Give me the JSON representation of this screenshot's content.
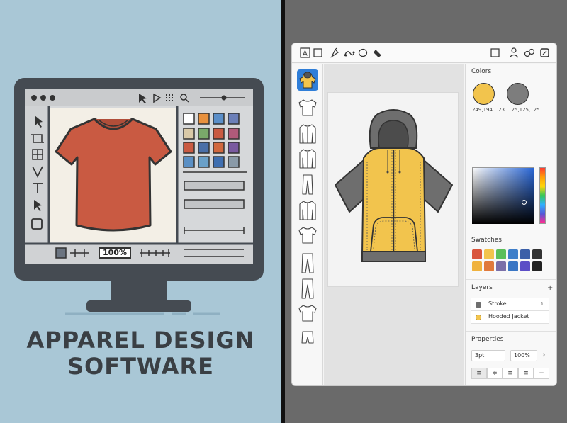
{
  "left": {
    "title_line1": "APPAREL DESIGN",
    "title_line2": "SOFTWARE",
    "zoom_label": "100%",
    "shirt_color": "#c95a42",
    "screen_bg": "#f3efe6"
  },
  "right": {
    "panel": {
      "colors_title": "Colors",
      "color1_label": "249,194",
      "color2_label": "23",
      "color3_label": "125,125,125",
      "primary_color": "#f2c44d",
      "secondary_color": "#7d7d7d",
      "swatches_title": "Swatches",
      "layers_title": "Layers",
      "layers_add": "+",
      "layers": [
        {
          "name": "Stroke",
          "color": "#6e6e6e",
          "count": "1"
        },
        {
          "name": "Hooded Jacket",
          "color": "#f2c44d"
        }
      ],
      "properties_title": "Properties",
      "stroke_width": "3pt",
      "opacity": "100%",
      "chevron": "›"
    },
    "jacket": {
      "body_color": "#f2c44d",
      "hood_color": "#6e6e6e"
    },
    "swatch_colors": [
      "#d9553d",
      "#f2c44d",
      "#5bbf5a",
      "#3e7ec9",
      "#3b5fa8",
      "#333333",
      "#f0b23e",
      "#e07a3c",
      "#7a6fa8",
      "#3a76c4",
      "#5b4dc6",
      "#222222"
    ]
  }
}
